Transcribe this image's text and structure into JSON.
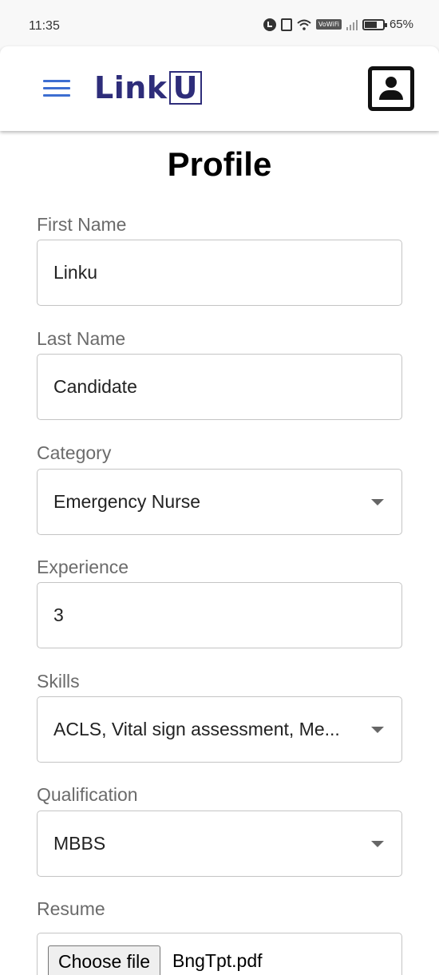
{
  "status_bar": {
    "time": "11:35",
    "vowifi": "VoWiFi",
    "battery": "65%"
  },
  "header": {
    "menu_icon": "hamburger-menu-icon",
    "logo_text": "Link",
    "logo_box_text": "U",
    "logo_color": "#2e2d7a",
    "accent_color": "#3d6ed1",
    "profile_icon": "profile-icon"
  },
  "page": {
    "title": "Profile"
  },
  "form": {
    "first_name": {
      "label": "First Name",
      "value": "Linku"
    },
    "last_name": {
      "label": "Last Name",
      "value": "Candidate"
    },
    "category": {
      "label": "Category",
      "value": "Emergency Nurse"
    },
    "experience": {
      "label": "Experience",
      "value": "3"
    },
    "skills": {
      "label": "Skills",
      "value": "ACLS, Vital sign assessment, Me..."
    },
    "qualification": {
      "label": "Qualification",
      "value": "MBBS"
    },
    "resume": {
      "label": "Resume",
      "button": "Choose file",
      "file_name": "BngTpt.pdf"
    }
  }
}
